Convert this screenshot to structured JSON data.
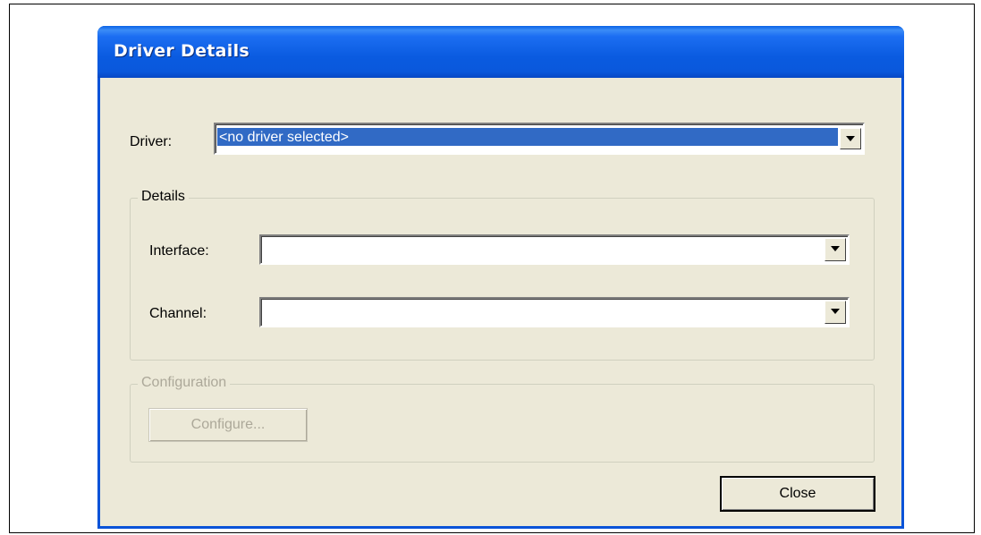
{
  "window": {
    "title": "Driver Details"
  },
  "driver": {
    "label": "Driver:",
    "value": "<no driver selected>"
  },
  "details_group": {
    "title": "Details",
    "interface_label": "Interface:",
    "interface_value": "",
    "channel_label": "Channel:",
    "channel_value": ""
  },
  "configuration_group": {
    "title": "Configuration",
    "configure_label": "Configure..."
  },
  "footer": {
    "close_label": "Close"
  },
  "colors": {
    "titlebar": "#0a5be0",
    "dialog_bg": "#ece9d8",
    "selection": "#316ac5",
    "disabled_text": "#aca899"
  },
  "icons": {
    "dropdown": "chevron-down-icon"
  }
}
